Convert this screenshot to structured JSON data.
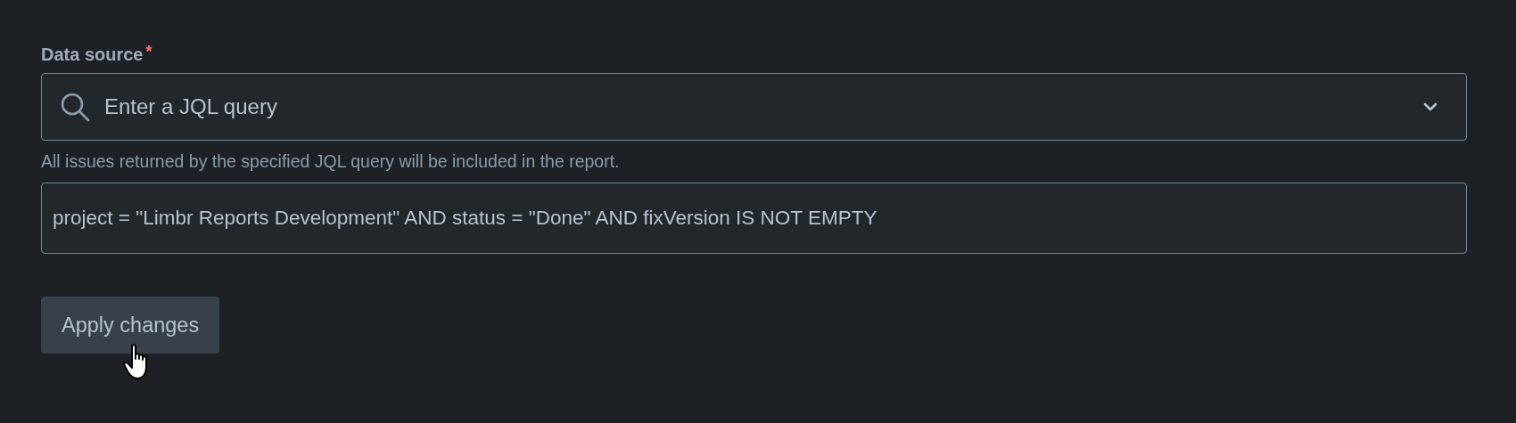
{
  "field": {
    "label": "Data source",
    "required_mark": "*"
  },
  "select": {
    "placeholder": "Enter a JQL query"
  },
  "helper": "All issues returned by the specified JQL query will be included in the report.",
  "query": {
    "value": "project = \"Limbr Reports Development\" AND status = \"Done\" AND fixVersion IS NOT EMPTY"
  },
  "buttons": [
    {
      "label": "Apply changes",
      "hovered": true
    }
  ]
}
